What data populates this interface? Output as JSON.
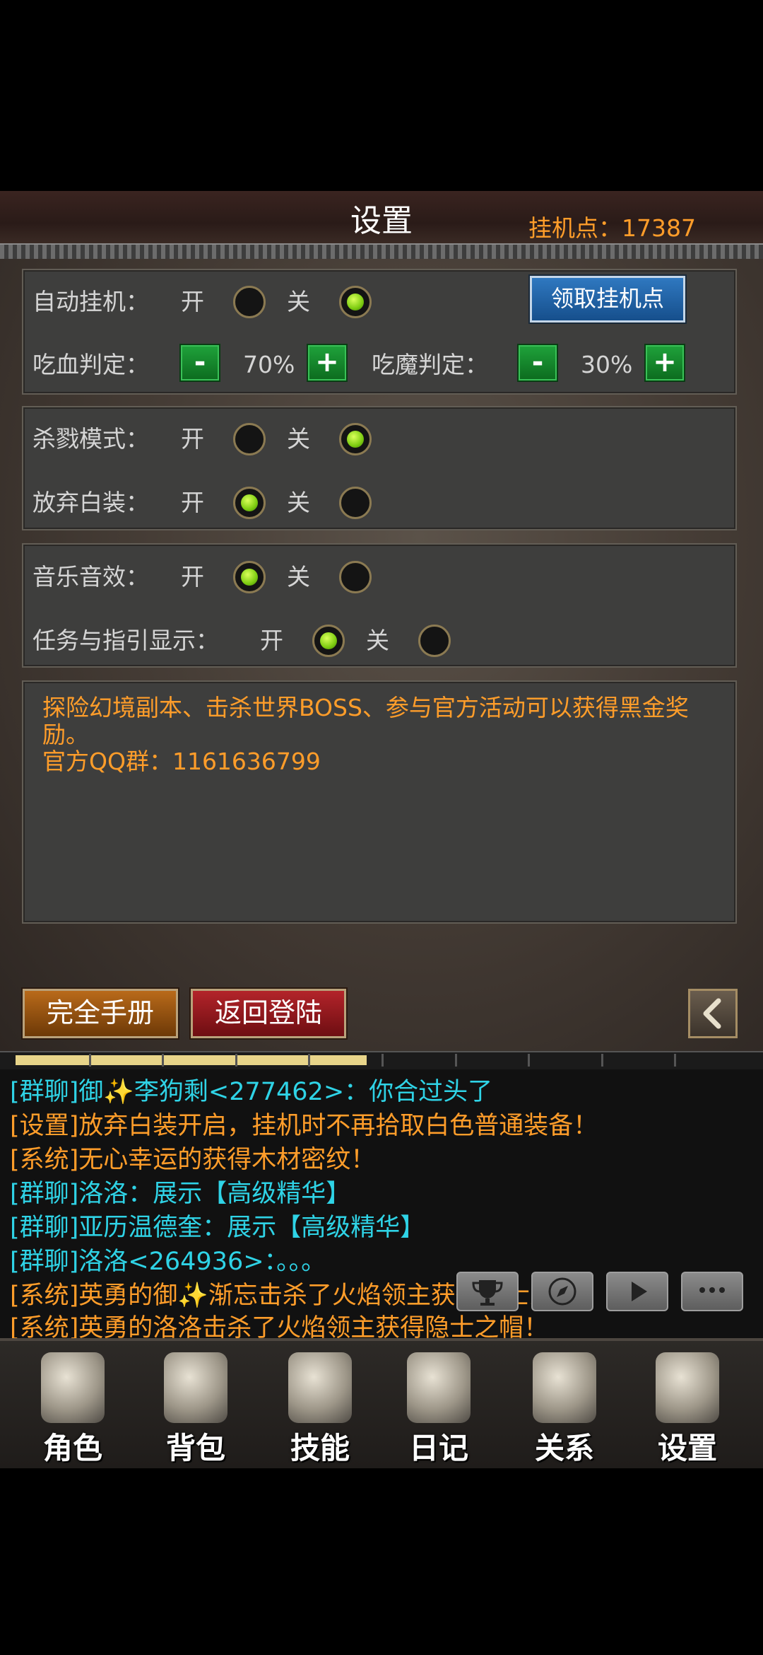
{
  "header": {
    "title": "设置",
    "hang_points": "挂机点：17387"
  },
  "auto_hang": {
    "label": "自动挂机：",
    "on": "开",
    "off": "关",
    "selected": "off",
    "claim_button": "领取挂机点"
  },
  "hp_rule": {
    "label": "吃血判定：",
    "minus": "-",
    "value": "70%",
    "plus": "+"
  },
  "mp_rule": {
    "label": "吃魔判定：",
    "minus": "-",
    "value": "30%",
    "plus": "+"
  },
  "kill_mode": {
    "label": "杀戮模式：",
    "on": "开",
    "off": "关",
    "selected": "off"
  },
  "discard_white": {
    "label": "放弃白装：",
    "on": "开",
    "off": "关",
    "selected": "on"
  },
  "music": {
    "label": "音乐音效：",
    "on": "开",
    "off": "关",
    "selected": "on"
  },
  "guide": {
    "label": "任务与指引显示：",
    "on": "开",
    "off": "关",
    "selected": "on"
  },
  "notice": {
    "line1": "探险幻境副本、击杀世界BOSS、参与官方活动可以获得黑金奖励。",
    "line2": "官方QQ群：1161636799"
  },
  "buttons": {
    "manual": "完全手册",
    "logout": "返回登陆"
  },
  "chat": [
    {
      "text": "[群聊]御✨李狗剩<277462>：你合过头了",
      "color": "cyan"
    },
    {
      "text": "[设置]放弃白装开启，挂机时不再拾取白色普通装备！",
      "color": "orange"
    },
    {
      "text": "[系统]无心幸运的获得木材密纹！",
      "color": "orange"
    },
    {
      "text": "[群聊]洛洛：展示【高级精华】",
      "color": "cyan"
    },
    {
      "text": "[群聊]亚历温德奎：展示【高级精华】",
      "color": "cyan"
    },
    {
      "text": "[群聊]洛洛<264936>：。。。",
      "color": "cyan"
    },
    {
      "text": "[系统]英勇的御✨渐忘击杀了火焰领主获得隐士之帽！",
      "color": "orange"
    },
    {
      "text": "[系统]英勇的洛洛击杀了火焰领主获得隐士之帽！",
      "color": "orange"
    }
  ],
  "nav": [
    {
      "label": "角色",
      "icon": "helmet-icon"
    },
    {
      "label": "背包",
      "icon": "backpack-icon"
    },
    {
      "label": "技能",
      "icon": "skill-book-icon"
    },
    {
      "label": "日记",
      "icon": "scroll-icon"
    },
    {
      "label": "关系",
      "icon": "handshake-icon"
    },
    {
      "label": "设置",
      "icon": "gear-icon"
    }
  ],
  "xp_progress": 0.48,
  "colors": {
    "accent_orange": "#ff9d2a",
    "chat_cyan": "#2fd3e6",
    "radio_on": "#7dcc11",
    "plus_minus_green": "#1fa33b"
  }
}
